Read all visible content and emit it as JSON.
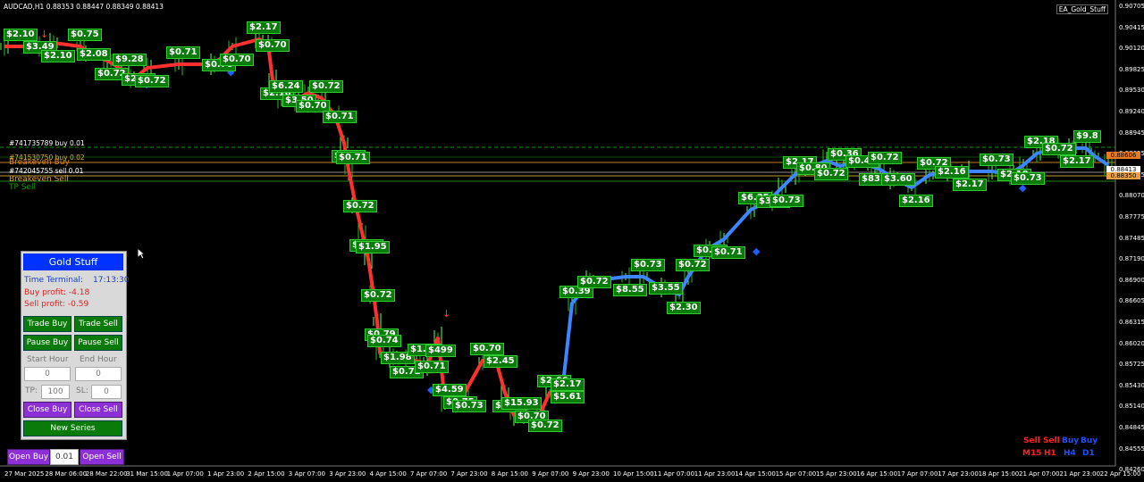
{
  "header": {
    "title": "AUDCAD,H1  0.88353 0.88447 0.88349 0.88413",
    "ea_name": "EA_Gold_Stuff"
  },
  "price_axis": [
    "0.90705",
    "0.90415",
    "0.90120",
    "0.89825",
    "0.89530",
    "0.89240",
    "0.88945",
    "0.88655",
    "0.88365",
    "0.88070",
    "0.87775",
    "0.87485",
    "0.87190",
    "0.86900",
    "0.86605",
    "0.86315",
    "0.86020",
    "0.85725",
    "0.85430",
    "0.85140",
    "0.84845",
    "0.84555",
    "0.84260"
  ],
  "time_axis": [
    "27 Mar 2025",
    "28 Mar 06:00",
    "28 Mar 22:00",
    "31 Mar 15:00",
    "1 Apr 07:00",
    "1 Apr 23:00",
    "2 Apr 15:00",
    "3 Apr 07:00",
    "3 Apr 23:00",
    "4 Apr 15:00",
    "7 Apr 07:00",
    "7 Apr 23:00",
    "8 Apr 15:00",
    "9 Apr 07:00",
    "9 Apr 23:00",
    "10 Apr 15:00",
    "11 Apr 07:00",
    "11 Apr 23:00",
    "14 Apr 15:00",
    "15 Apr 07:00",
    "15 Apr 23:00",
    "16 Apr 15:00",
    "17 Apr 07:00",
    "17 Apr 23:00",
    "18 Apr 15:00",
    "21 Apr 07:00",
    "21 Apr 23:00",
    "22 Apr 15:00"
  ],
  "levels": {
    "order_buy": "#741735789 buy 0.01",
    "order_buy2": "#741530750 buy 0.02",
    "breakeven_buy": "Breakeven Buy",
    "order_sell": "#742045755 sell 0.01",
    "breakeven_sell": "Breakeven Sell",
    "tp_sell": "TP Sell"
  },
  "price_boxes": {
    "box1": "0.88606",
    "box2": "0.88413",
    "box3": "0.88350"
  },
  "trade_tags": [
    {
      "t": "$2.10"
    },
    {
      "t": "$3.49"
    },
    {
      "t": "$2.10"
    },
    {
      "t": "$0.75"
    },
    {
      "t": "$2.08"
    },
    {
      "t": "$0.72"
    },
    {
      "t": "$9.28"
    },
    {
      "t": "$2.10"
    },
    {
      "t": "$0.72"
    },
    {
      "t": "$0.71"
    },
    {
      "t": "$0.70"
    },
    {
      "t": "$0.70"
    },
    {
      "t": "$2.17"
    },
    {
      "t": "$0.70"
    },
    {
      "t": "$2.16"
    },
    {
      "t": "$6.24"
    },
    {
      "t": "$3.50"
    },
    {
      "t": "$0.70"
    },
    {
      "t": "$0.72"
    },
    {
      "t": "$0.71"
    },
    {
      "t": "$5.68"
    },
    {
      "t": "$0.71"
    },
    {
      "t": "$0.72"
    },
    {
      "t": "$0.71"
    },
    {
      "t": "$1.95"
    },
    {
      "t": "$0.72"
    },
    {
      "t": "$0.79"
    },
    {
      "t": "$0.74"
    },
    {
      "t": "$1.98"
    },
    {
      "t": "$0.72"
    },
    {
      "t": "$1.91"
    },
    {
      "t": "$0.71"
    },
    {
      "t": "$499"
    },
    {
      "t": "$4.59"
    },
    {
      "t": "$0.75"
    },
    {
      "t": "$0.73"
    },
    {
      "t": "$0.70"
    },
    {
      "t": "$2.45"
    },
    {
      "t": "$0.14"
    },
    {
      "t": "$15.93"
    },
    {
      "t": "$0.70"
    },
    {
      "t": "$0.72"
    },
    {
      "t": "$2.66"
    },
    {
      "t": "$2.17"
    },
    {
      "t": "$5.61"
    },
    {
      "t": "$0.39"
    },
    {
      "t": "$0.72"
    },
    {
      "t": "$8.55"
    },
    {
      "t": "$0.73"
    },
    {
      "t": "$3.55"
    },
    {
      "t": "$2.30"
    },
    {
      "t": "$0.72"
    },
    {
      "t": "$0.80"
    },
    {
      "t": "$0.71"
    },
    {
      "t": "$6.35"
    },
    {
      "t": "$3.75"
    },
    {
      "t": "$0.73"
    },
    {
      "t": "$2.17"
    },
    {
      "t": "$0.80"
    },
    {
      "t": "$0.72"
    },
    {
      "t": "$0.36"
    },
    {
      "t": "$0.44"
    },
    {
      "t": "$83.03"
    },
    {
      "t": "$0.72"
    },
    {
      "t": "$3.60"
    },
    {
      "t": "$2.16"
    },
    {
      "t": "$0.72"
    },
    {
      "t": "$2.16"
    },
    {
      "t": "$2.17"
    },
    {
      "t": "$0.73"
    },
    {
      "t": "$2.10"
    },
    {
      "t": "$0.73"
    },
    {
      "t": "$2.18"
    },
    {
      "t": "$0.72"
    },
    {
      "t": "$2.17"
    },
    {
      "t": "$9.8"
    }
  ],
  "panel": {
    "title": "Gold Stuff",
    "time_label": "Time Terminal:",
    "time_value": "17:13:30",
    "buy_profit": "Buy profit: -4.18",
    "sell_profit": "Sell profit: -0.59",
    "trade_buy": "Trade Buy",
    "trade_sell": "Trade Sell",
    "pause_buy": "Pause Buy",
    "pause_sell": "Pause Sell",
    "start_hour_label": "Start Hour",
    "end_hour_label": "End Hour",
    "start_hour_value": "0",
    "end_hour_value": "0",
    "tp_label": "TP:",
    "tp_value": "100",
    "sl_label": "SL:",
    "sl_value": "0",
    "close_buy": "Close Buy",
    "close_sell": "Close Sell",
    "new_series": "New Series"
  },
  "bottom_bar": {
    "open_buy": "Open Buy",
    "lot_value": "0.01",
    "open_sell": "Open Sell"
  },
  "mtf": {
    "row1": [
      "Sell",
      "Sell",
      "Buy",
      "Buy"
    ],
    "row2": [
      "M15",
      "H1",
      "H4",
      "D1"
    ]
  },
  "colors": {
    "background": "#000000",
    "up_line": "#3d86ff",
    "down_line": "#ff3030",
    "tag_bg": "#0a7a0a",
    "panel_title": "#0032ff",
    "purple_button": "#8d2fd6"
  }
}
